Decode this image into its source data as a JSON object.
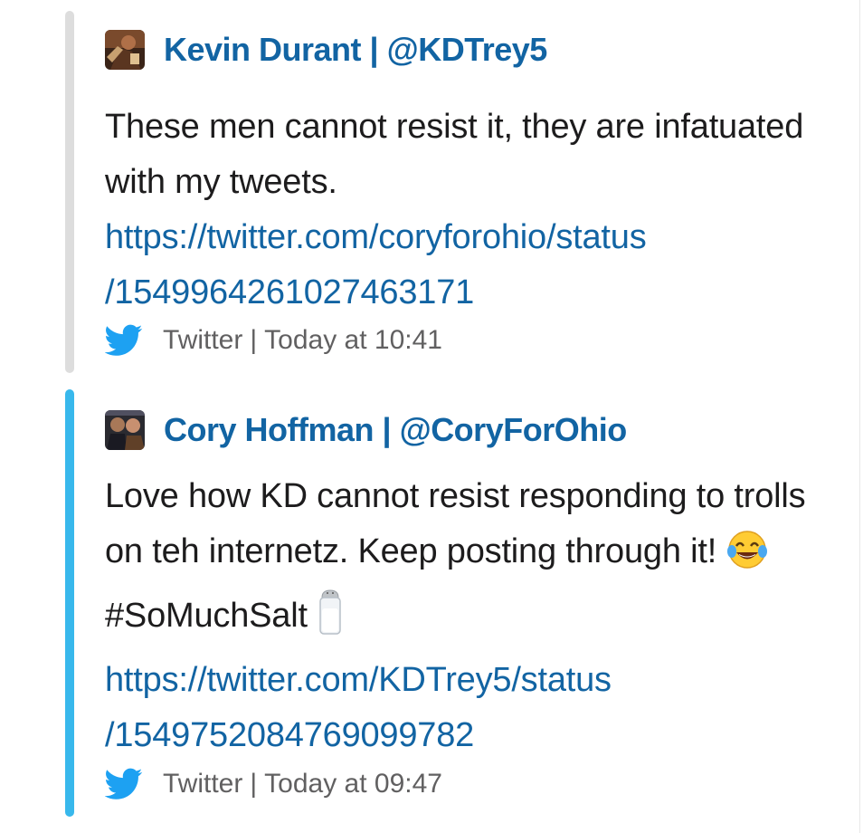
{
  "messages": [
    {
      "author": "Kevin Durant | @KDTrey5",
      "text": "These men cannot resist it, they are infatuated with my tweets.",
      "link_line1": "https://twitter.com/coryforohio/status",
      "link_line2": "/1549964261027463171",
      "source": "Twitter",
      "separator": "|",
      "timestamp": "Today at 10:41",
      "bar_color": "#dddddd"
    },
    {
      "author": "Cory Hoffman | @CoryForOhio",
      "text_line": "Love how KD cannot resist responding to trolls on teh internetz. Keep posting through it!",
      "hashtag": "#SoMuchSalt",
      "link_line1": "https://twitter.com/KDTrey5/status",
      "link_line2": "/1549752084769099782",
      "source": "Twitter",
      "separator": "|",
      "timestamp": "Today at 09:47",
      "bar_color": "#38b8ec"
    }
  ],
  "icons": {
    "twitter": "twitter-bird-icon",
    "laugh_emoji": "face-with-tears-of-joy-icon",
    "salt_emoji": "salt-shaker-icon"
  },
  "colors": {
    "link": "#1264a3",
    "text": "#1d1c1d",
    "muted": "#616061",
    "twitter_blue": "#1da1f2"
  }
}
